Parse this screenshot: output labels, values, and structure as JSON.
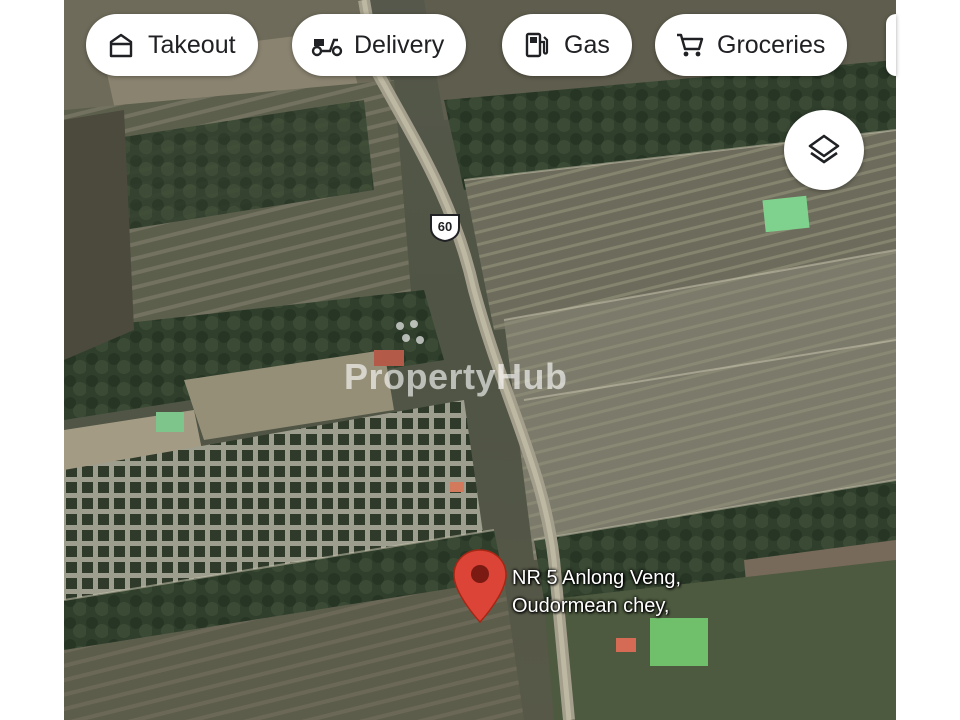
{
  "filter_chips": [
    {
      "label": "Takeout",
      "icon": "takeout-icon"
    },
    {
      "label": "Delivery",
      "icon": "delivery-scooter-icon"
    },
    {
      "label": "Gas",
      "icon": "gas-station-icon"
    },
    {
      "label": "Groceries",
      "icon": "shopping-cart-icon"
    }
  ],
  "map": {
    "layers_button_icon": "layers-icon",
    "road_shield_number": "60",
    "watermark_text": "PropertyHub",
    "pin_icon": "location-pin-icon",
    "place_label_line1": "NR 5 Anlong Veng,",
    "place_label_line2": "Oudormean chey,"
  },
  "colors": {
    "pin_red": "#db4437",
    "road": "#9a9a8a",
    "chip_background": "#ffffff",
    "text_dark": "#202124"
  }
}
